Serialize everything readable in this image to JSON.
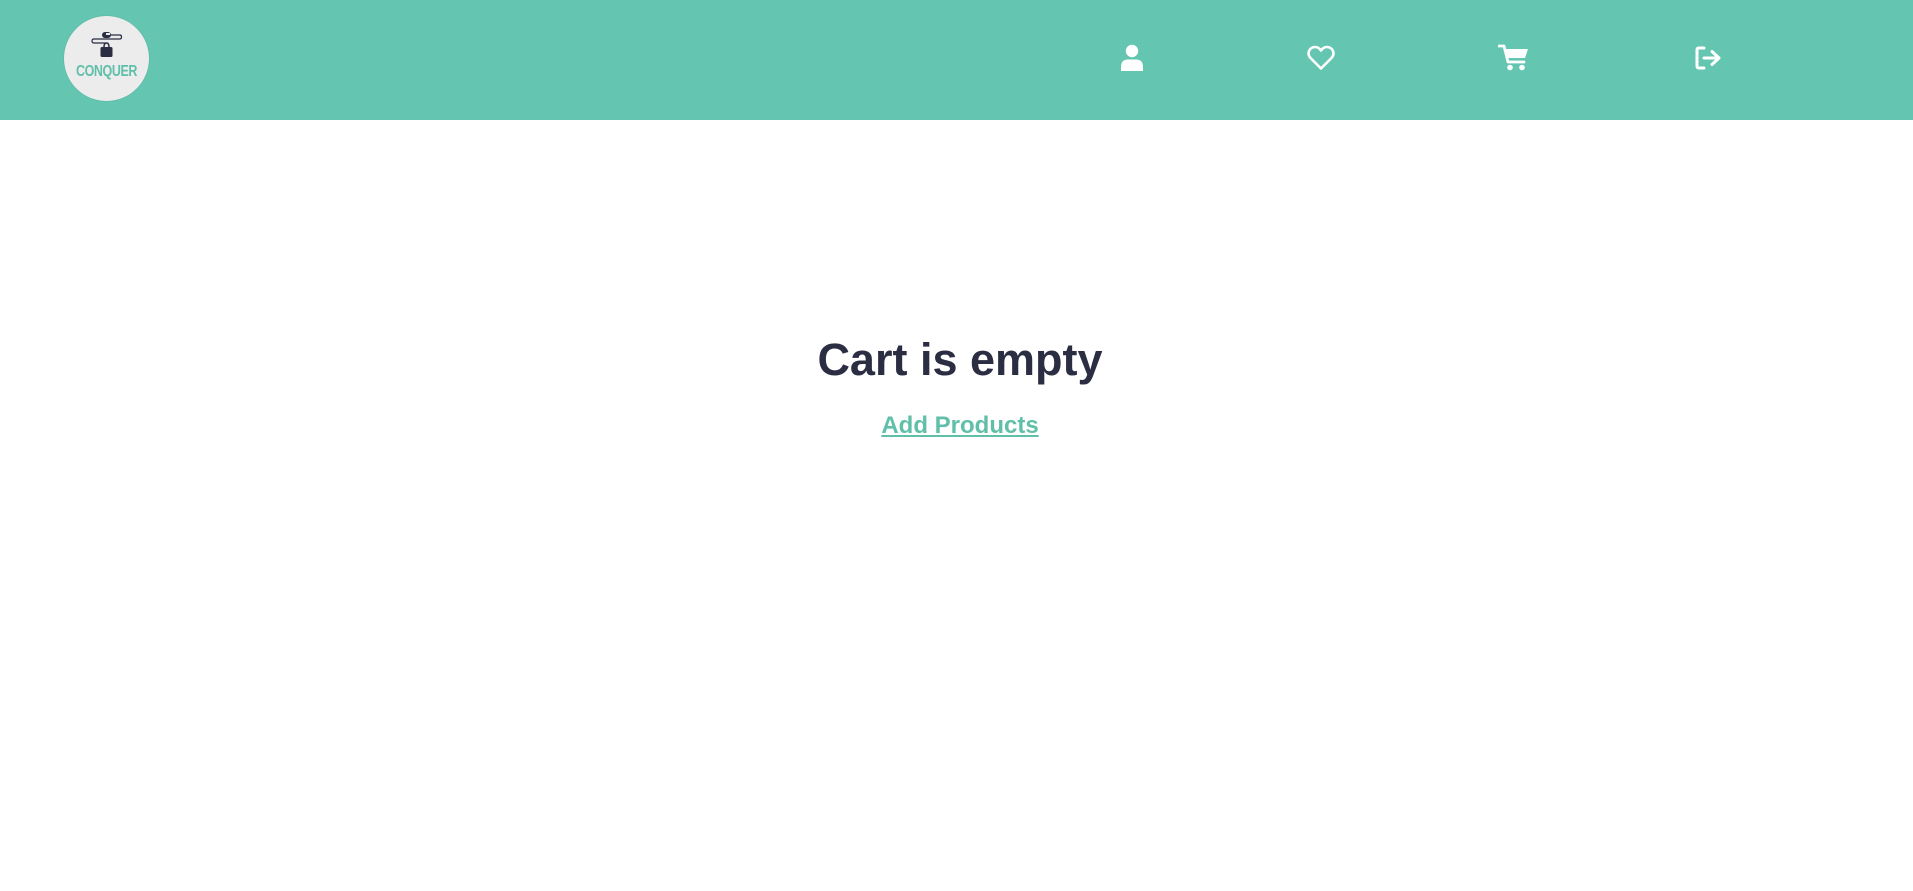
{
  "header": {
    "logo": {
      "text": "CONQUER",
      "icon": "mouse-shopping-bag-logo-icon"
    },
    "nav_icons": [
      {
        "name": "user-icon",
        "label": ""
      },
      {
        "name": "heart-icon",
        "label": ""
      },
      {
        "name": "cart-icon",
        "label": ""
      },
      {
        "name": "logout-icon",
        "label": ""
      }
    ]
  },
  "main": {
    "title": "Cart is empty",
    "add_products_link": "Add Products"
  },
  "colors": {
    "navbar": "#64c6b1",
    "accent": "#5fbfa9",
    "text_dark": "#2b2d42",
    "icon": "#ffffff"
  }
}
